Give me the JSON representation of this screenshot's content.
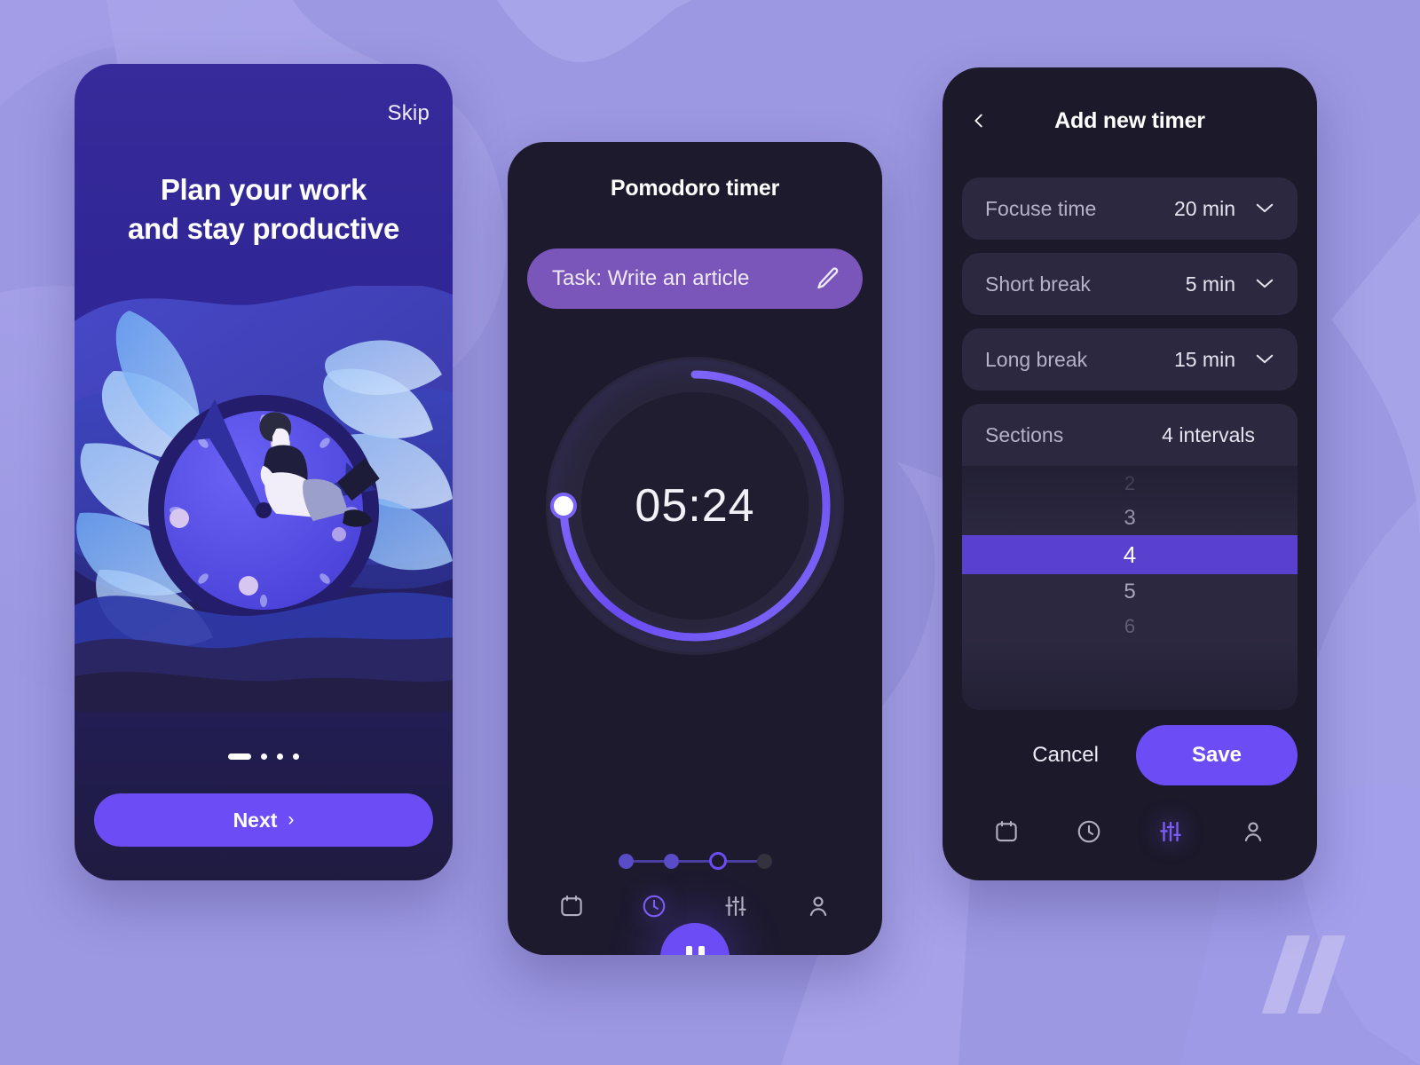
{
  "background": {
    "color": "#9c98e2",
    "logo_name": "double-slash-logo"
  },
  "onboarding": {
    "skip_label": "Skip",
    "headline_line1": "Plan your work",
    "headline_line2": "and stay productive",
    "next_label": "Next",
    "next_chevron": "›",
    "pager": {
      "total": 4,
      "current": 1
    },
    "illustration_name": "person-on-clock-with-leaves"
  },
  "timer": {
    "title": "Pomodoro timer",
    "task_label": "Task: Write an article",
    "task_edit_icon": "pencil-icon",
    "time_remaining": "05:24",
    "progress_percent": 75,
    "steps": {
      "total": 4,
      "completed": 2,
      "current": 3
    },
    "play_state": "paused",
    "play_icon": "pause-icon",
    "nav": [
      {
        "name": "calendar",
        "active": false
      },
      {
        "name": "clock",
        "active": true
      },
      {
        "name": "sliders",
        "active": false
      },
      {
        "name": "profile",
        "active": false
      }
    ]
  },
  "add_timer": {
    "title": "Add new timer",
    "back_icon": "chevron-left-icon",
    "rows": [
      {
        "label": "Focuse time",
        "value": "20 min",
        "caret": "chevron-down-icon"
      },
      {
        "label": "Short break",
        "value": "5 min",
        "caret": "chevron-down-icon"
      },
      {
        "label": "Long break",
        "value": "15 min",
        "caret": "chevron-down-icon"
      }
    ],
    "picker": {
      "label": "Sections",
      "value": "4 intervals",
      "caret": "chevron-up-icon",
      "options": [
        "2",
        "3",
        "4",
        "5",
        "6"
      ],
      "selected": "4"
    },
    "cancel_label": "Cancel",
    "save_label": "Save",
    "nav": [
      {
        "name": "calendar",
        "active": false
      },
      {
        "name": "clock",
        "active": false
      },
      {
        "name": "sliders",
        "active": true
      },
      {
        "name": "profile",
        "active": false
      }
    ]
  },
  "colors": {
    "accent": "#6c4df5",
    "accent_dark": "#5940cf",
    "task_field": "#7a55ba",
    "card": "#2b2840",
    "phone_dark": "#1d1a2e",
    "onboard_top": "#372a9a"
  }
}
